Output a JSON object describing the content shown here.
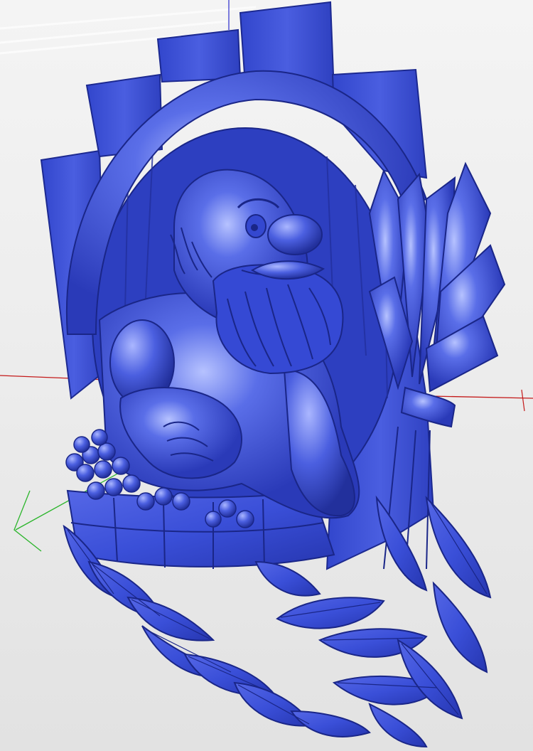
{
  "viewport": {
    "background_top": "#f4f4f4",
    "background_bottom": "#e2e2e2",
    "model_color": "#3a4fd8",
    "model_highlight": "#8a9cff",
    "model_shadow": "#1d2a8a",
    "axis_x_color": "#c41a1a",
    "axis_y_color": "#2bb52b",
    "axis_z_color": "#3a3ad0",
    "model_icon": "relief-3d-model",
    "axes_icon": "xyz-axes"
  }
}
